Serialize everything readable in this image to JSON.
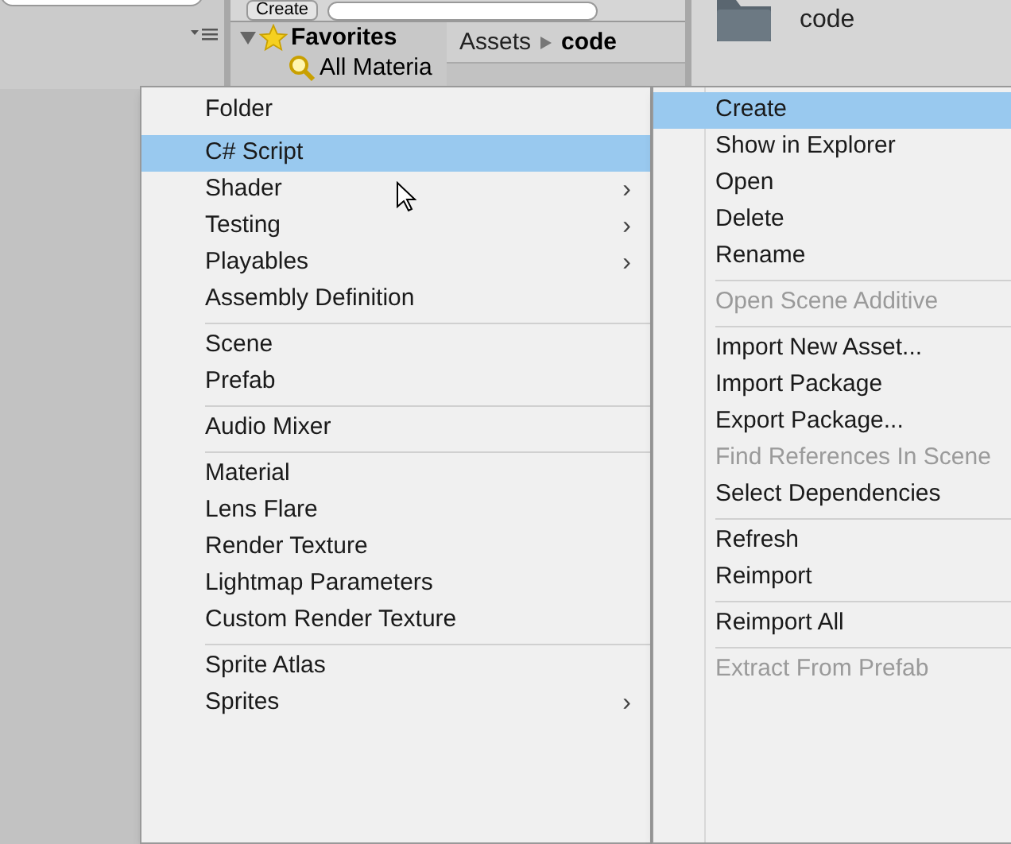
{
  "toolbar": {
    "create_button": "Create"
  },
  "favorites": {
    "label": "Favorites",
    "expanded": true,
    "children": [
      {
        "label": "All Materia"
      }
    ]
  },
  "breadcrumb": [
    {
      "label": "Assets",
      "selected": false
    },
    {
      "label": "code",
      "selected": true
    }
  ],
  "folder": {
    "label": "code"
  },
  "create_menu": [
    {
      "kind": "item",
      "label": "Folder",
      "selected": false
    },
    {
      "kind": "item",
      "label": "C# Script",
      "selected": true
    },
    {
      "kind": "item",
      "label": "Shader",
      "selected": false,
      "arrow": "›"
    },
    {
      "kind": "item",
      "label": "Testing",
      "selected": false,
      "arrow": "›"
    },
    {
      "kind": "item",
      "label": "Playables",
      "selected": false,
      "arrow": "›"
    },
    {
      "kind": "item",
      "label": "Assembly Definition",
      "selected": false
    },
    {
      "kind": "separator"
    },
    {
      "kind": "item",
      "label": "Scene",
      "selected": false
    },
    {
      "kind": "item",
      "label": "Prefab",
      "selected": false
    },
    {
      "kind": "separator"
    },
    {
      "kind": "item",
      "label": "Audio Mixer",
      "selected": false
    },
    {
      "kind": "separator"
    },
    {
      "kind": "item",
      "label": "Material",
      "selected": false
    },
    {
      "kind": "item",
      "label": "Lens Flare",
      "selected": false
    },
    {
      "kind": "item",
      "label": "Render Texture",
      "selected": false
    },
    {
      "kind": "item",
      "label": "Lightmap Parameters",
      "selected": false
    },
    {
      "kind": "item",
      "label": "Custom Render Texture",
      "selected": false
    },
    {
      "kind": "separator"
    },
    {
      "kind": "item",
      "label": "Sprite Atlas",
      "selected": false
    },
    {
      "kind": "item",
      "label": "Sprites",
      "selected": false,
      "arrow": "›"
    }
  ],
  "asset_menu": [
    {
      "kind": "item",
      "label": "Create",
      "selected": true,
      "disabled": false
    },
    {
      "kind": "item",
      "label": "Show in Explorer",
      "selected": false,
      "disabled": false
    },
    {
      "kind": "item",
      "label": "Open",
      "selected": false,
      "disabled": false
    },
    {
      "kind": "item",
      "label": "Delete",
      "selected": false,
      "disabled": false
    },
    {
      "kind": "item",
      "label": "Rename",
      "selected": false,
      "disabled": false
    },
    {
      "kind": "separator"
    },
    {
      "kind": "item",
      "label": "Open Scene Additive",
      "selected": false,
      "disabled": true
    },
    {
      "kind": "separator"
    },
    {
      "kind": "item",
      "label": "Import New Asset...",
      "selected": false,
      "disabled": false
    },
    {
      "kind": "item",
      "label": "Import Package",
      "selected": false,
      "disabled": false
    },
    {
      "kind": "item",
      "label": "Export Package...",
      "selected": false,
      "disabled": false
    },
    {
      "kind": "item",
      "label": "Find References In Scene",
      "selected": false,
      "disabled": true
    },
    {
      "kind": "item",
      "label": "Select Dependencies",
      "selected": false,
      "disabled": false
    },
    {
      "kind": "separator"
    },
    {
      "kind": "item",
      "label": "Refresh",
      "selected": false,
      "disabled": false
    },
    {
      "kind": "item",
      "label": "Reimport",
      "selected": false,
      "disabled": false
    },
    {
      "kind": "separator"
    },
    {
      "kind": "item",
      "label": "Reimport All",
      "selected": false,
      "disabled": false
    },
    {
      "kind": "separator"
    },
    {
      "kind": "item",
      "label": "Extract From Prefab",
      "selected": false,
      "disabled": true
    }
  ]
}
